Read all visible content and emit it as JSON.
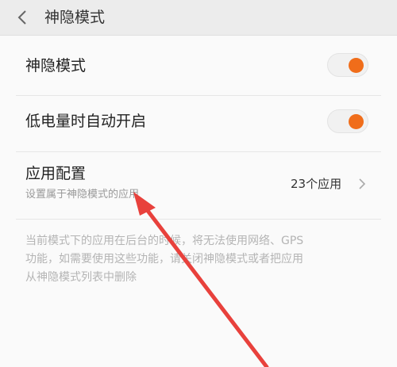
{
  "header": {
    "title": "神隐模式"
  },
  "settings": {
    "mode_toggle": {
      "label": "神隐模式",
      "on": true
    },
    "auto_toggle": {
      "label": "低电量时自动开启",
      "on": true
    },
    "app_config": {
      "label": "应用配置",
      "sublabel": "设置属于神隐模式的应用",
      "value": "23个应用"
    }
  },
  "note": {
    "line1": "当前模式下的应用在后台的时候，将无法使用网络、GPS",
    "line2": "功能，如需要使用这些功能，请关闭神隐模式或者把应用",
    "line3": "从神隐模式列表中删除"
  },
  "colors": {
    "accent": "#f06d1a",
    "annotation_arrow": "#e8413c"
  },
  "icons": {
    "back": "chevron-left-icon",
    "forward": "chevron-right-icon"
  }
}
